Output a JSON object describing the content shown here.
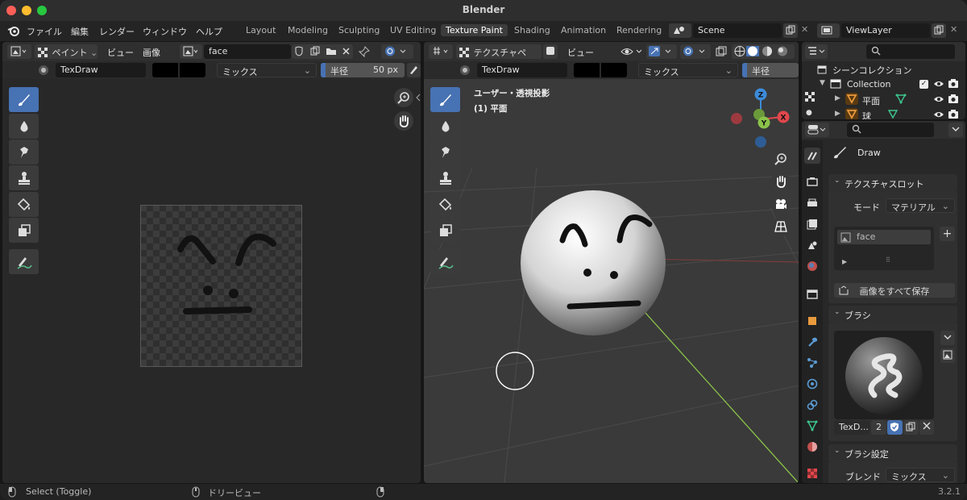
{
  "window": {
    "title": "Blender"
  },
  "menu": {
    "items": [
      "ファイル",
      "編集",
      "レンダー",
      "ウィンドウ",
      "ヘルプ"
    ]
  },
  "workspaces": [
    "Layout",
    "Modeling",
    "Sculpting",
    "UV Editing",
    "Texture Paint",
    "Shading",
    "Animation",
    "Rendering"
  ],
  "active_workspace": "Texture Paint",
  "scene": {
    "name": "Scene"
  },
  "view_layer": {
    "name": "ViewLayer"
  },
  "image_editor": {
    "mode": "ペイント",
    "menu_view": "ビュー",
    "menu_image": "画像",
    "image_name": "face",
    "brush_name": "TexDraw",
    "blend": "ミックス",
    "radius_label": "半径",
    "radius_value": "50 px"
  },
  "viewport": {
    "mode": "テクスチャペ",
    "menu_view": "ビュー",
    "brush_name": "TexDraw",
    "blend": "ミックス",
    "radius_label": "半径",
    "overlay_line1": "ユーザー・透視投影",
    "overlay_line2": "(1) 平面",
    "gizmo": {
      "x": "X",
      "y": "Y",
      "z": "Z"
    }
  },
  "outliner": {
    "scene_collection": "シーンコレクション",
    "collection": "Collection",
    "objects": [
      {
        "name": "平面"
      },
      {
        "name": "球"
      }
    ]
  },
  "properties": {
    "tool_name": "Draw",
    "texture_slots_title": "テクスチャスロット",
    "mode_label": "モード",
    "mode_value": "マテリアル",
    "slot_name": "face",
    "save_all": "画像をすべて保存",
    "brush_title": "ブラシ",
    "brush_name": "TexD...",
    "brush_users": "2",
    "brush_settings_title": "ブラシ設定",
    "blend_label": "ブレンド",
    "blend_value": "ミックス"
  },
  "status": {
    "select": "Select (Toggle)",
    "dolly": "ドリービュー",
    "version": "3.2.1"
  },
  "colors": {
    "accent": "#4772b3",
    "x_axis": "#e0474c",
    "y_axis": "#8bc34a",
    "z_axis": "#3d8bd9",
    "mesh_green": "#3ec68e",
    "mesh_orange": "#e99a3c"
  }
}
